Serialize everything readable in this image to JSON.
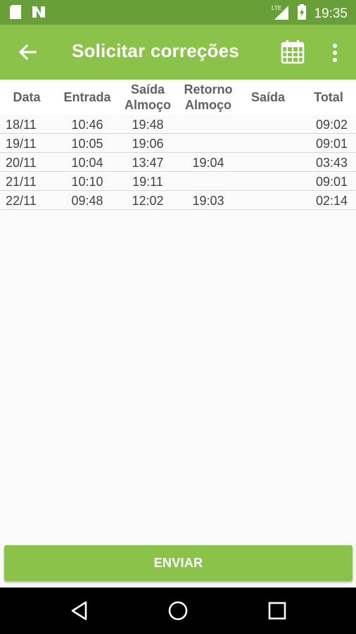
{
  "status_bar": {
    "time": "19:35",
    "network_label": "LTE",
    "icons": [
      "sd-card-icon",
      "n-logo-icon",
      "signal-icon",
      "battery-charging-icon"
    ]
  },
  "app_bar": {
    "title": "Solicitar correções",
    "icons": [
      "back-arrow-icon",
      "calendar-icon",
      "more-vert-icon"
    ]
  },
  "table": {
    "headers": {
      "data": "Data",
      "entrada": "Entrada",
      "saida_almoco": [
        "Saída",
        "Almoço"
      ],
      "retorno_almoco": [
        "Retorno",
        "Almoço"
      ],
      "saida": "Saída",
      "total": "Total"
    },
    "rows": [
      {
        "data": "18/11",
        "entrada": "10:46",
        "saida_almoco": "19:48",
        "retorno_almoco": "",
        "saida": "",
        "total": "09:02"
      },
      {
        "data": "19/11",
        "entrada": "10:05",
        "saida_almoco": "19:06",
        "retorno_almoco": "",
        "saida": "",
        "total": "09:01"
      },
      {
        "data": "20/11",
        "entrada": "10:04",
        "saida_almoco": "13:47",
        "retorno_almoco": "19:04",
        "saida": "",
        "total": "03:43"
      },
      {
        "data": "21/11",
        "entrada": "10:10",
        "saida_almoco": "19:11",
        "retorno_almoco": "",
        "saida": "",
        "total": "09:01"
      },
      {
        "data": "22/11",
        "entrada": "09:48",
        "saida_almoco": "12:02",
        "retorno_almoco": "19:03",
        "saida": "",
        "total": "02:14"
      }
    ]
  },
  "actions": {
    "send_label": "ENVIAR"
  },
  "nav_bar": {
    "icons": [
      "back-triangle-icon",
      "home-circle-icon",
      "recents-square-icon"
    ]
  },
  "colors": {
    "status_bar": "#689f38",
    "primary": "#8bc34a",
    "header_text": "#616161",
    "cell_text": "#424242"
  }
}
